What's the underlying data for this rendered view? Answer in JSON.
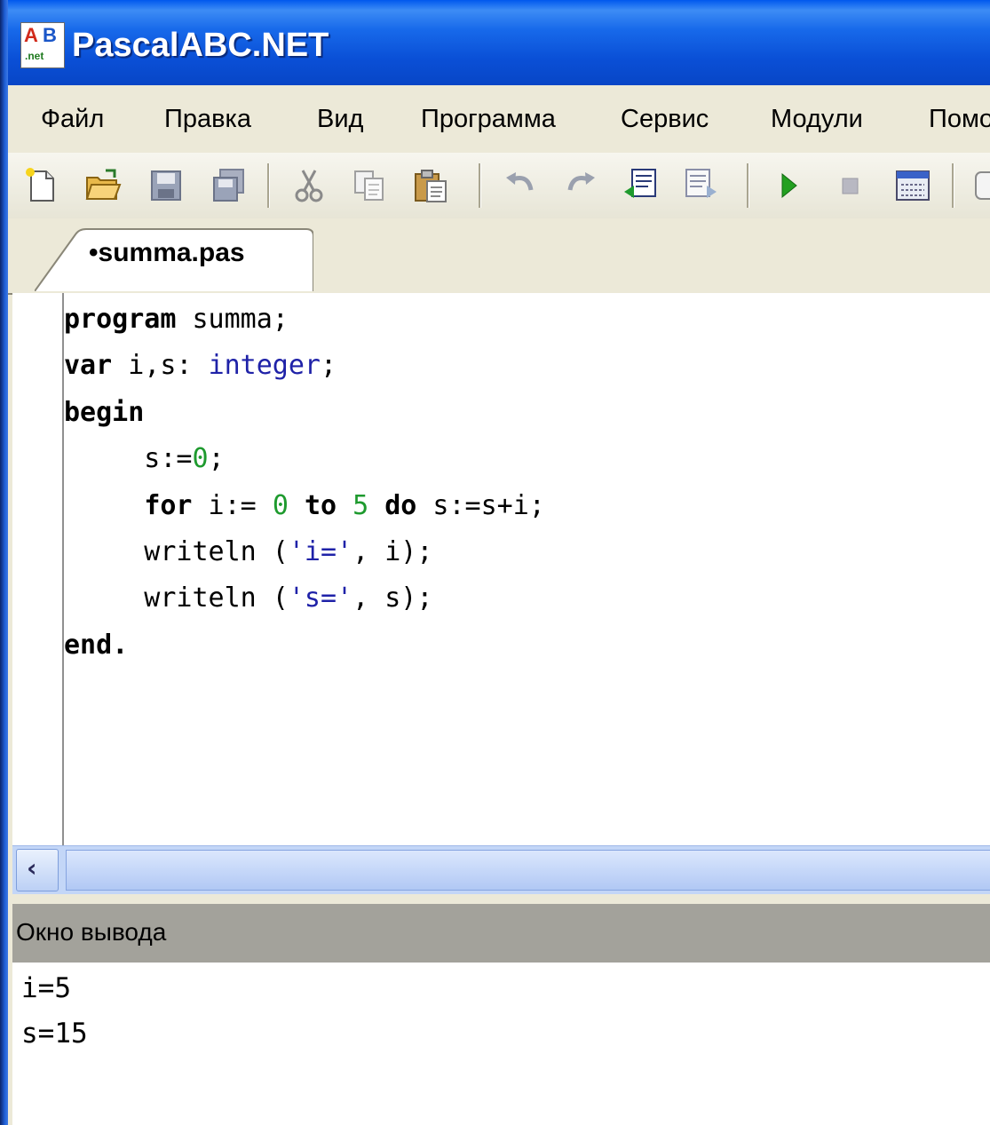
{
  "window": {
    "title": "PascalABC.NET",
    "icon": {
      "top": "AB",
      "sub": ".net"
    }
  },
  "menu": {
    "items": [
      "Файл",
      "Правка",
      "Вид",
      "Программа",
      "Сервис",
      "Модули",
      "Помо"
    ]
  },
  "toolbar": {
    "icons": [
      "new-file-icon",
      "open-folder-icon",
      "save-icon",
      "save-all-icon",
      "cut-icon",
      "copy-icon",
      "paste-icon",
      "undo-icon",
      "redo-icon",
      "indent-icon",
      "outdent-icon",
      "run-icon",
      "stop-icon",
      "compile-icon",
      "help-icon"
    ]
  },
  "editor": {
    "tab_label": "•summa.pas",
    "code": {
      "l1_kw": "program",
      "l1_rest": " summa;",
      "l2_kw": "var",
      "l2_mid": " i,s: ",
      "l2_type": "integer",
      "l2_end": ";",
      "l3_kw": "begin",
      "l4_a": "     s:=",
      "l4_num": "0",
      "l4_end": ";",
      "l5_pad": "     ",
      "l5_for": "for",
      "l5_a": " i:= ",
      "l5_n1": "0",
      "l5_sp1": " ",
      "l5_to": "to",
      "l5_sp2": " ",
      "l5_n2": "5",
      "l5_sp3": " ",
      "l5_do": "do",
      "l5_end": " s:=s+i;",
      "l6_a": "     writeln (",
      "l6_str": "'i='",
      "l6_end": ", i);",
      "l7_a": "     writeln (",
      "l7_str": "'s='",
      "l7_end": ", s);",
      "l8_kw": "end",
      "l8_end": "."
    }
  },
  "output": {
    "title": "Окно вывода",
    "lines": [
      "i=5",
      "s=15"
    ]
  }
}
